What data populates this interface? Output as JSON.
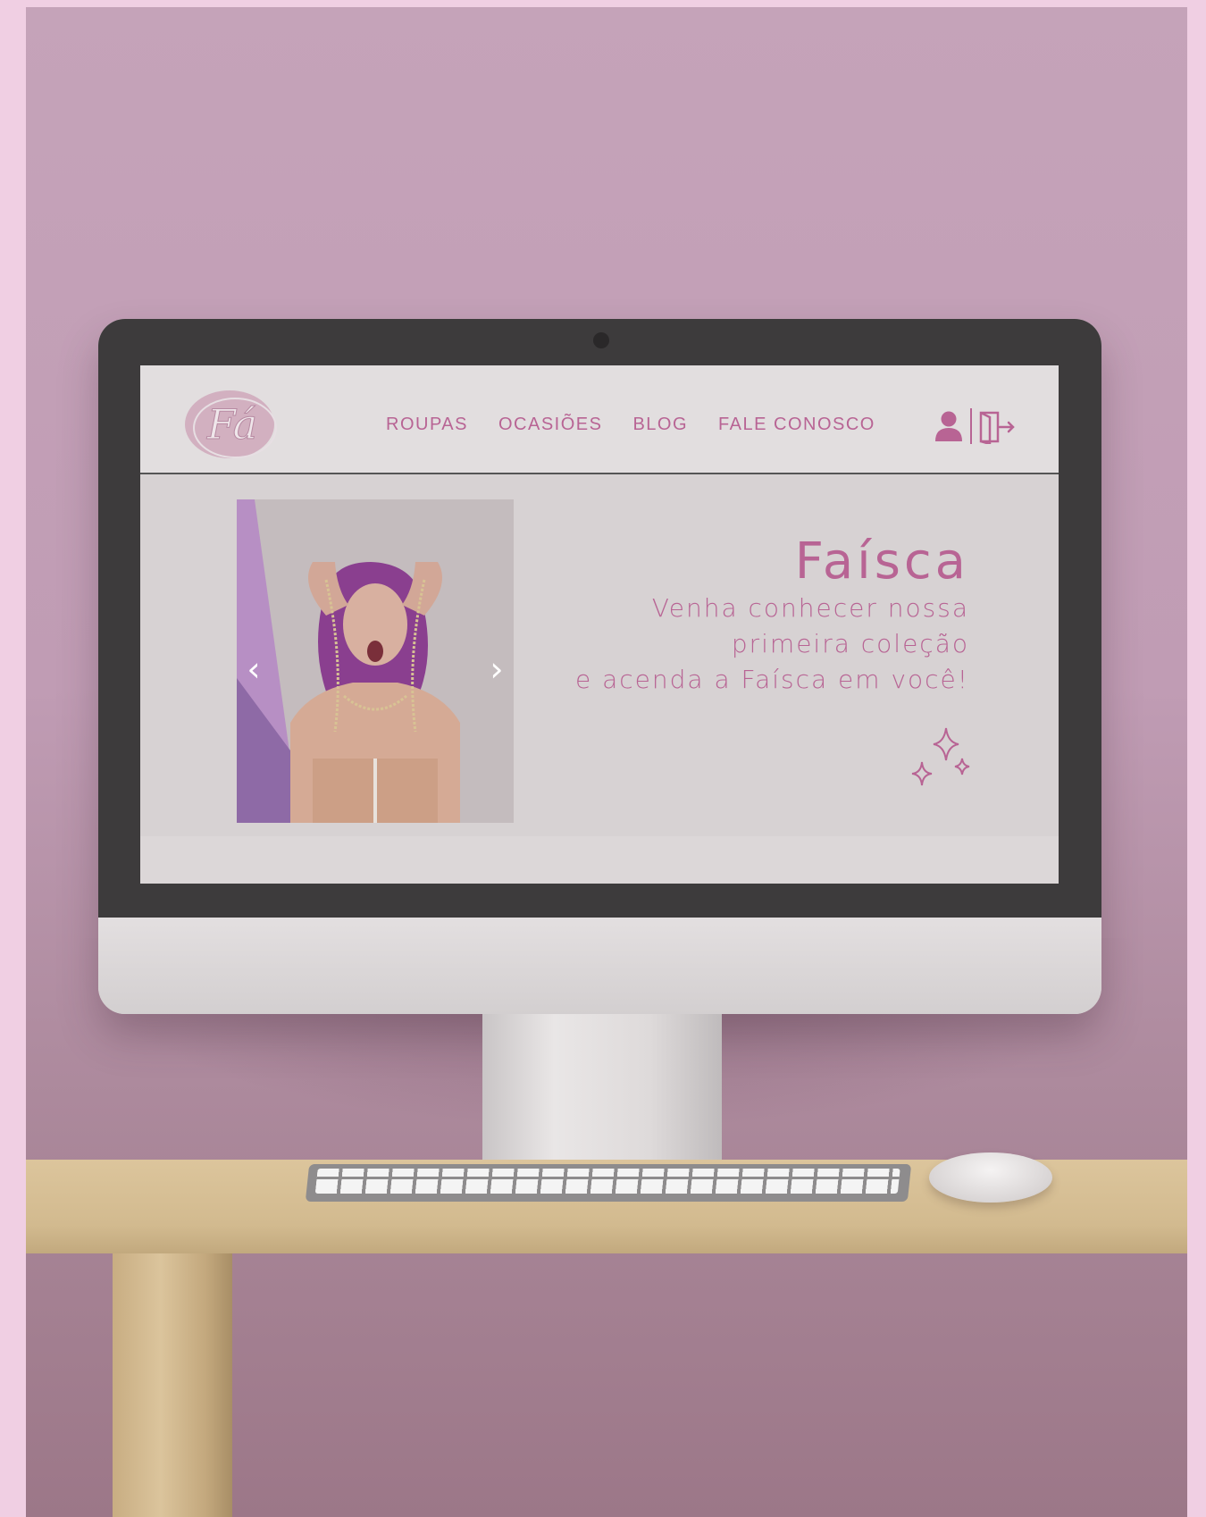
{
  "header": {
    "logo_text": "Fá",
    "nav": [
      "ROUPAS",
      "OCASIÕES",
      "BLOG",
      "FALE CONOSCO"
    ],
    "icons": [
      "user-icon",
      "logout-icon"
    ]
  },
  "hero": {
    "title": "Faísca",
    "subtitle_lines": [
      "Venha conhecer nossa",
      "primeira coleção",
      "e acenda a Faísca em você!"
    ],
    "carousel": {
      "prev": "‹",
      "next": "›"
    },
    "decoration": "sparkles-icon"
  },
  "colors": {
    "accent": "#b86494",
    "screen_bg": "#dcd7d8",
    "wall": "#c5a3b9",
    "page_bg": "#f0cfe3",
    "bezel": "#3d3b3c"
  }
}
